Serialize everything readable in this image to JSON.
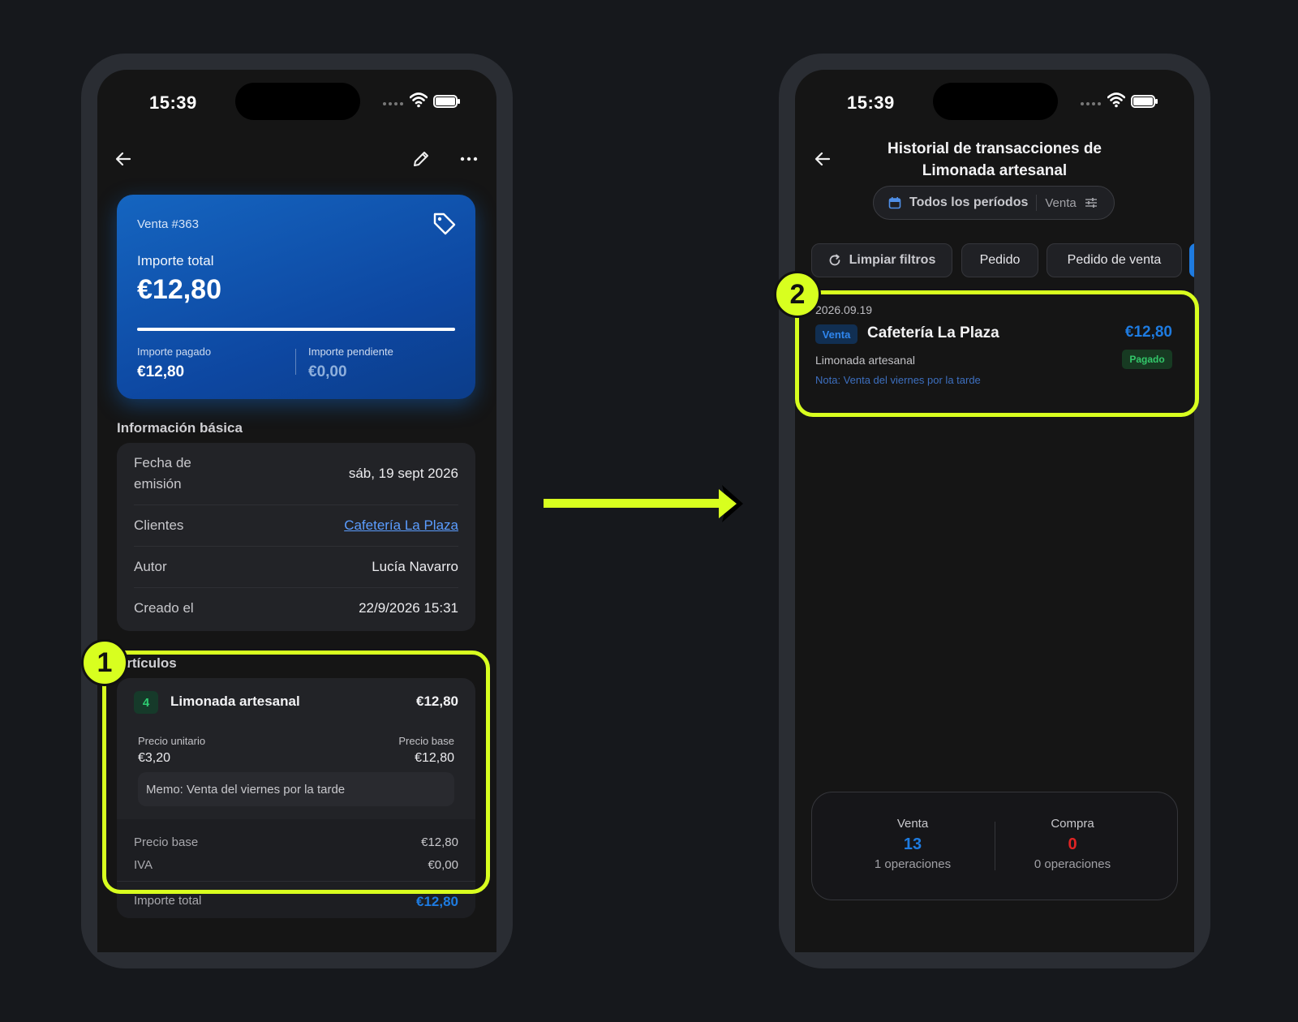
{
  "left_phone": {
    "status": {
      "time": "15:39"
    },
    "header": {
      "back": "back-icon",
      "edit": "pencil-icon",
      "more": "more-icon"
    },
    "sale_card": {
      "sale_number": "Venta #363",
      "total_label": "Importe total",
      "total_value": "€12,80",
      "paid_fraction": 1.0,
      "paid_label": "Importe pagado",
      "paid_value": "€12,80",
      "pending_label": "Importe pendiente",
      "pending_value": "€0,00"
    },
    "basic_info": {
      "title": "Información básica",
      "rows": [
        {
          "key": "Fecha de emisión",
          "value": "sáb, 19 sept 2026"
        },
        {
          "key": "Clientes",
          "value": "Cafetería La Plaza"
        },
        {
          "key": "Autor",
          "value": "Lucía Navarro"
        },
        {
          "key": "Creado el",
          "value": "22/9/2026 15:31"
        }
      ]
    },
    "items": {
      "title": "Artículos",
      "item": {
        "qty": "4",
        "name": "Limonada artesanal",
        "total": "€12,80",
        "unit_price_label": "Precio unitario",
        "unit_price": "€3,20",
        "base_price_label": "Precio base",
        "base_price": "€12,80",
        "memo": "Memo: Venta del viernes por la tarde"
      },
      "summary": {
        "base_label": "Precio base",
        "base_value": "€12,80",
        "tax_label": "IVA",
        "tax_value": "€0,00",
        "total_label": "Importe total",
        "total_value": "€12,80"
      }
    }
  },
  "right_phone": {
    "status": {
      "time": "15:39"
    },
    "title": "Historial de transacciones de Limonada artesanal",
    "period_filter": {
      "label": "Todos los períodos",
      "type": "Venta"
    },
    "chips": [
      "Limpiar filtros",
      "Pedido",
      "Pedido de venta"
    ],
    "transaction": {
      "date": "2026.09.19",
      "type": "Venta",
      "customer": "Cafetería La Plaza",
      "amount": "€12,80",
      "product": "Limonada artesanal",
      "status": "Pagado",
      "note": "Nota: Venta del viernes por la tarde"
    },
    "summary": {
      "sale_label": "Venta",
      "sale_value": "13",
      "sale_count": "1 operaciones",
      "purchase_label": "Compra",
      "purchase_value": "0",
      "purchase_count": "0 operaciones"
    }
  },
  "annotations": {
    "marker_1": "1",
    "marker_2": "2"
  },
  "colors": {
    "highlight": "#d8ff1f",
    "accent": "#1e7be0",
    "negative": "#e02424",
    "paid": "#33c76a"
  }
}
